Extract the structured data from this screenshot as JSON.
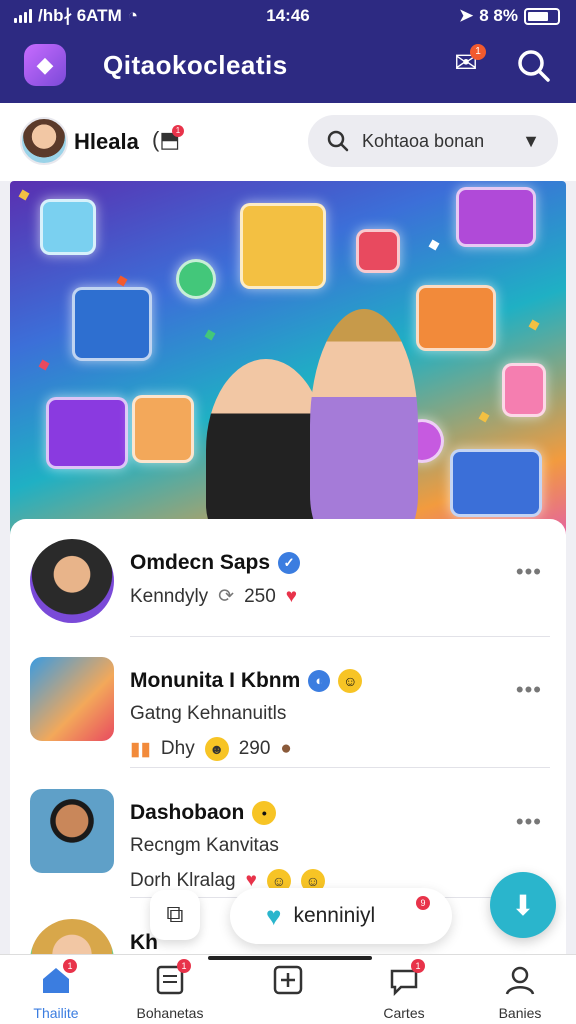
{
  "status_bar": {
    "carrier": "/hb∤ 6ATM",
    "time": "14:46",
    "battery": "8 8%"
  },
  "app_bar": {
    "title": "Qitaokocleatis",
    "notification_badge": "1"
  },
  "profile": {
    "name": "Hleala",
    "chip_badge": "1"
  },
  "search": {
    "placeholder": "Kohtaoa bonan"
  },
  "feed": [
    {
      "title": "Omdecn Saps",
      "line2": "Kenndyly",
      "count": "250",
      "verified_color": "#3b7de0"
    },
    {
      "title": "Monunita I Kbnm",
      "line2": "Gatng Kehnanuitls",
      "line3": "Dhy",
      "count": "290"
    },
    {
      "title": "Dashobaon",
      "line2": "Recngm Kanvitas",
      "line3": "Dorh Klralag"
    },
    {
      "title": "Kh",
      "line2": ""
    }
  ],
  "floating": {
    "pill_label": "kenniniyl",
    "pill_badge": "9"
  },
  "bottom_nav": [
    {
      "label": "Thailite",
      "badge": "1"
    },
    {
      "label": "Bohanetas",
      "badge": "1"
    },
    {
      "label": "",
      "badge": ""
    },
    {
      "label": "Cartes",
      "badge": "1"
    },
    {
      "label": "Banies",
      "badge": ""
    }
  ],
  "colors": {
    "header": "#2d2a82",
    "accent": "#3b7de0",
    "fab": "#2ab5cc",
    "badge": "#e8334a"
  },
  "icons": {
    "app": "app-logo-icon",
    "notif": "notification-bell-icon",
    "search": "search-icon"
  }
}
